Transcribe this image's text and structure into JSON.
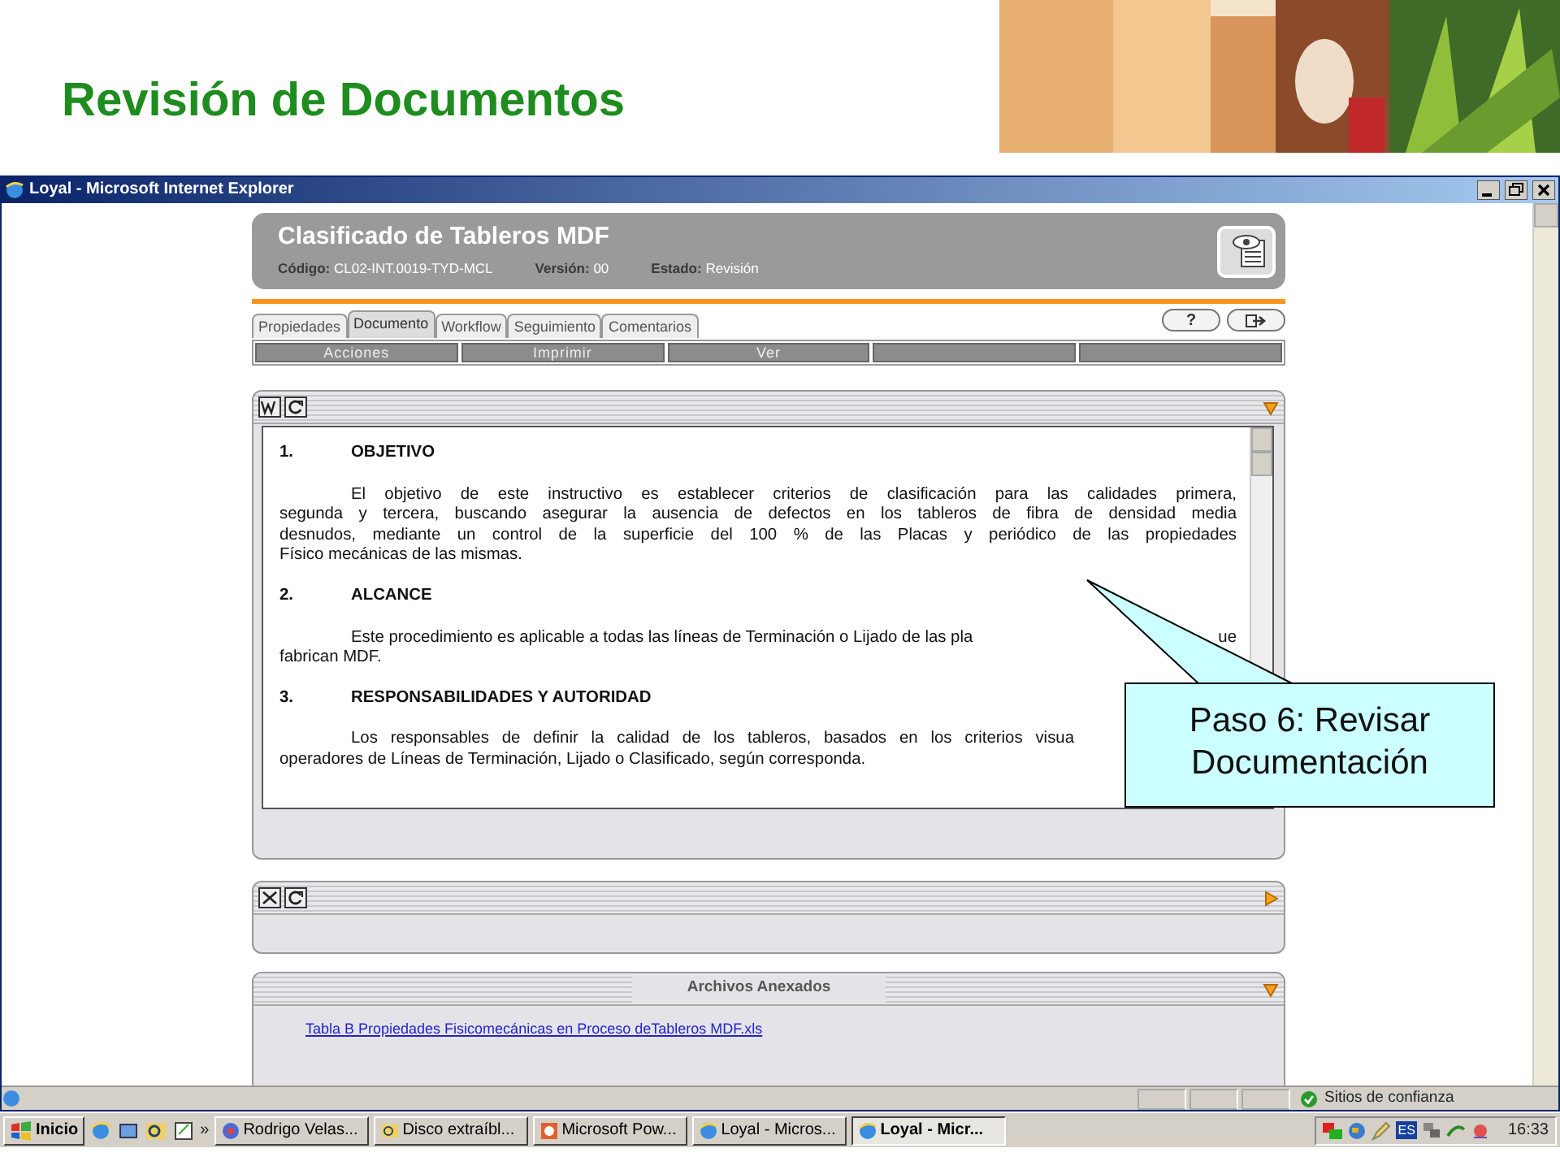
{
  "slide_title": "Revisión de Documentos",
  "logo": {
    "kind": "picture"
  },
  "window": {
    "title": "Loyal - Microsoft Internet Explorer"
  },
  "document_header": {
    "title": "Clasificado de Tableros MDF",
    "fields": [
      {
        "label": "Código:",
        "value": "CL02-INT.0019-TYD-MCL"
      },
      {
        "label": "Versión:",
        "value": "00"
      },
      {
        "label": "Estado:",
        "value": "Revisión"
      }
    ]
  },
  "tabs": [
    {
      "label": "Propiedades",
      "selected": false
    },
    {
      "label": "Documento",
      "selected": true
    },
    {
      "label": "Workflow",
      "selected": false
    },
    {
      "label": "Seguimiento",
      "selected": false
    },
    {
      "label": "Comentarios",
      "selected": false
    }
  ],
  "header_buttons": [
    "?"
  ],
  "actions": [
    {
      "kind": "button",
      "label": "Acciones"
    },
    {
      "kind": "button",
      "label": "Imprimir"
    },
    {
      "kind": "button",
      "label": "Ver"
    },
    {
      "kind": "blank"
    },
    {
      "kind": "blank"
    }
  ],
  "document": {
    "sections": [
      {
        "number": "1.",
        "heading": "OBJETIVO",
        "lines": [
          {
            "kind": "text",
            "text": "El objetivo de este instructivo es establecer criterios de clasificación para las calidades primera,"
          },
          {
            "kind": "text",
            "text": "segunda y  tercera,  buscando asegurar la ausencia de defectos en los tableros de fibra de densidad media"
          },
          {
            "kind": "text",
            "text": "desnudos, mediante un control de la superficie del 100 % de las Placas y periódico de las propiedades"
          },
          {
            "kind": "text",
            "text": "Físico mecánicas de las mismas."
          }
        ]
      },
      {
        "number": "2.",
        "heading": "ALCANCE",
        "lines": [
          {
            "kind": "split",
            "parts": [
              "Este procedimiento es aplicable a todas las líneas de Terminación o Lijado de las pla",
              "ue"
            ]
          },
          {
            "kind": "text",
            "text": "fabrican MDF."
          }
        ]
      },
      {
        "number": "3.",
        "heading": "RESPONSABILIDADES Y AUTORIDAD",
        "lines": [
          {
            "kind": "cut",
            "text": "Los responsables de definir la calidad de los tableros,  basados en los criterios  visua"
          },
          {
            "kind": "text",
            "text": "operadores de Líneas de Terminación, Lijado o Clasificado, según corresponda."
          }
        ]
      }
    ]
  },
  "attachments": {
    "title": "Archivos Anexados",
    "files": [
      "Tabla B Propiedades Fisicomecánicas en Proceso deTableros MDF.xls"
    ]
  },
  "callout": "Paso 6: Revisar Documentación",
  "status_bar": {
    "zone": "Sitios de confianza"
  },
  "taskbar": {
    "start": "Inicio",
    "more": "»",
    "tasks": [
      {
        "label": "Rodrigo Velas...",
        "selected": false
      },
      {
        "label": "Disco extraíbl...",
        "selected": false
      },
      {
        "label": "Microsoft Pow...",
        "selected": false
      },
      {
        "label": "Loyal - Micros...",
        "selected": false
      },
      {
        "label": "Loyal - Micr...",
        "selected": true
      }
    ],
    "language": "ES",
    "clock": "16:33"
  }
}
